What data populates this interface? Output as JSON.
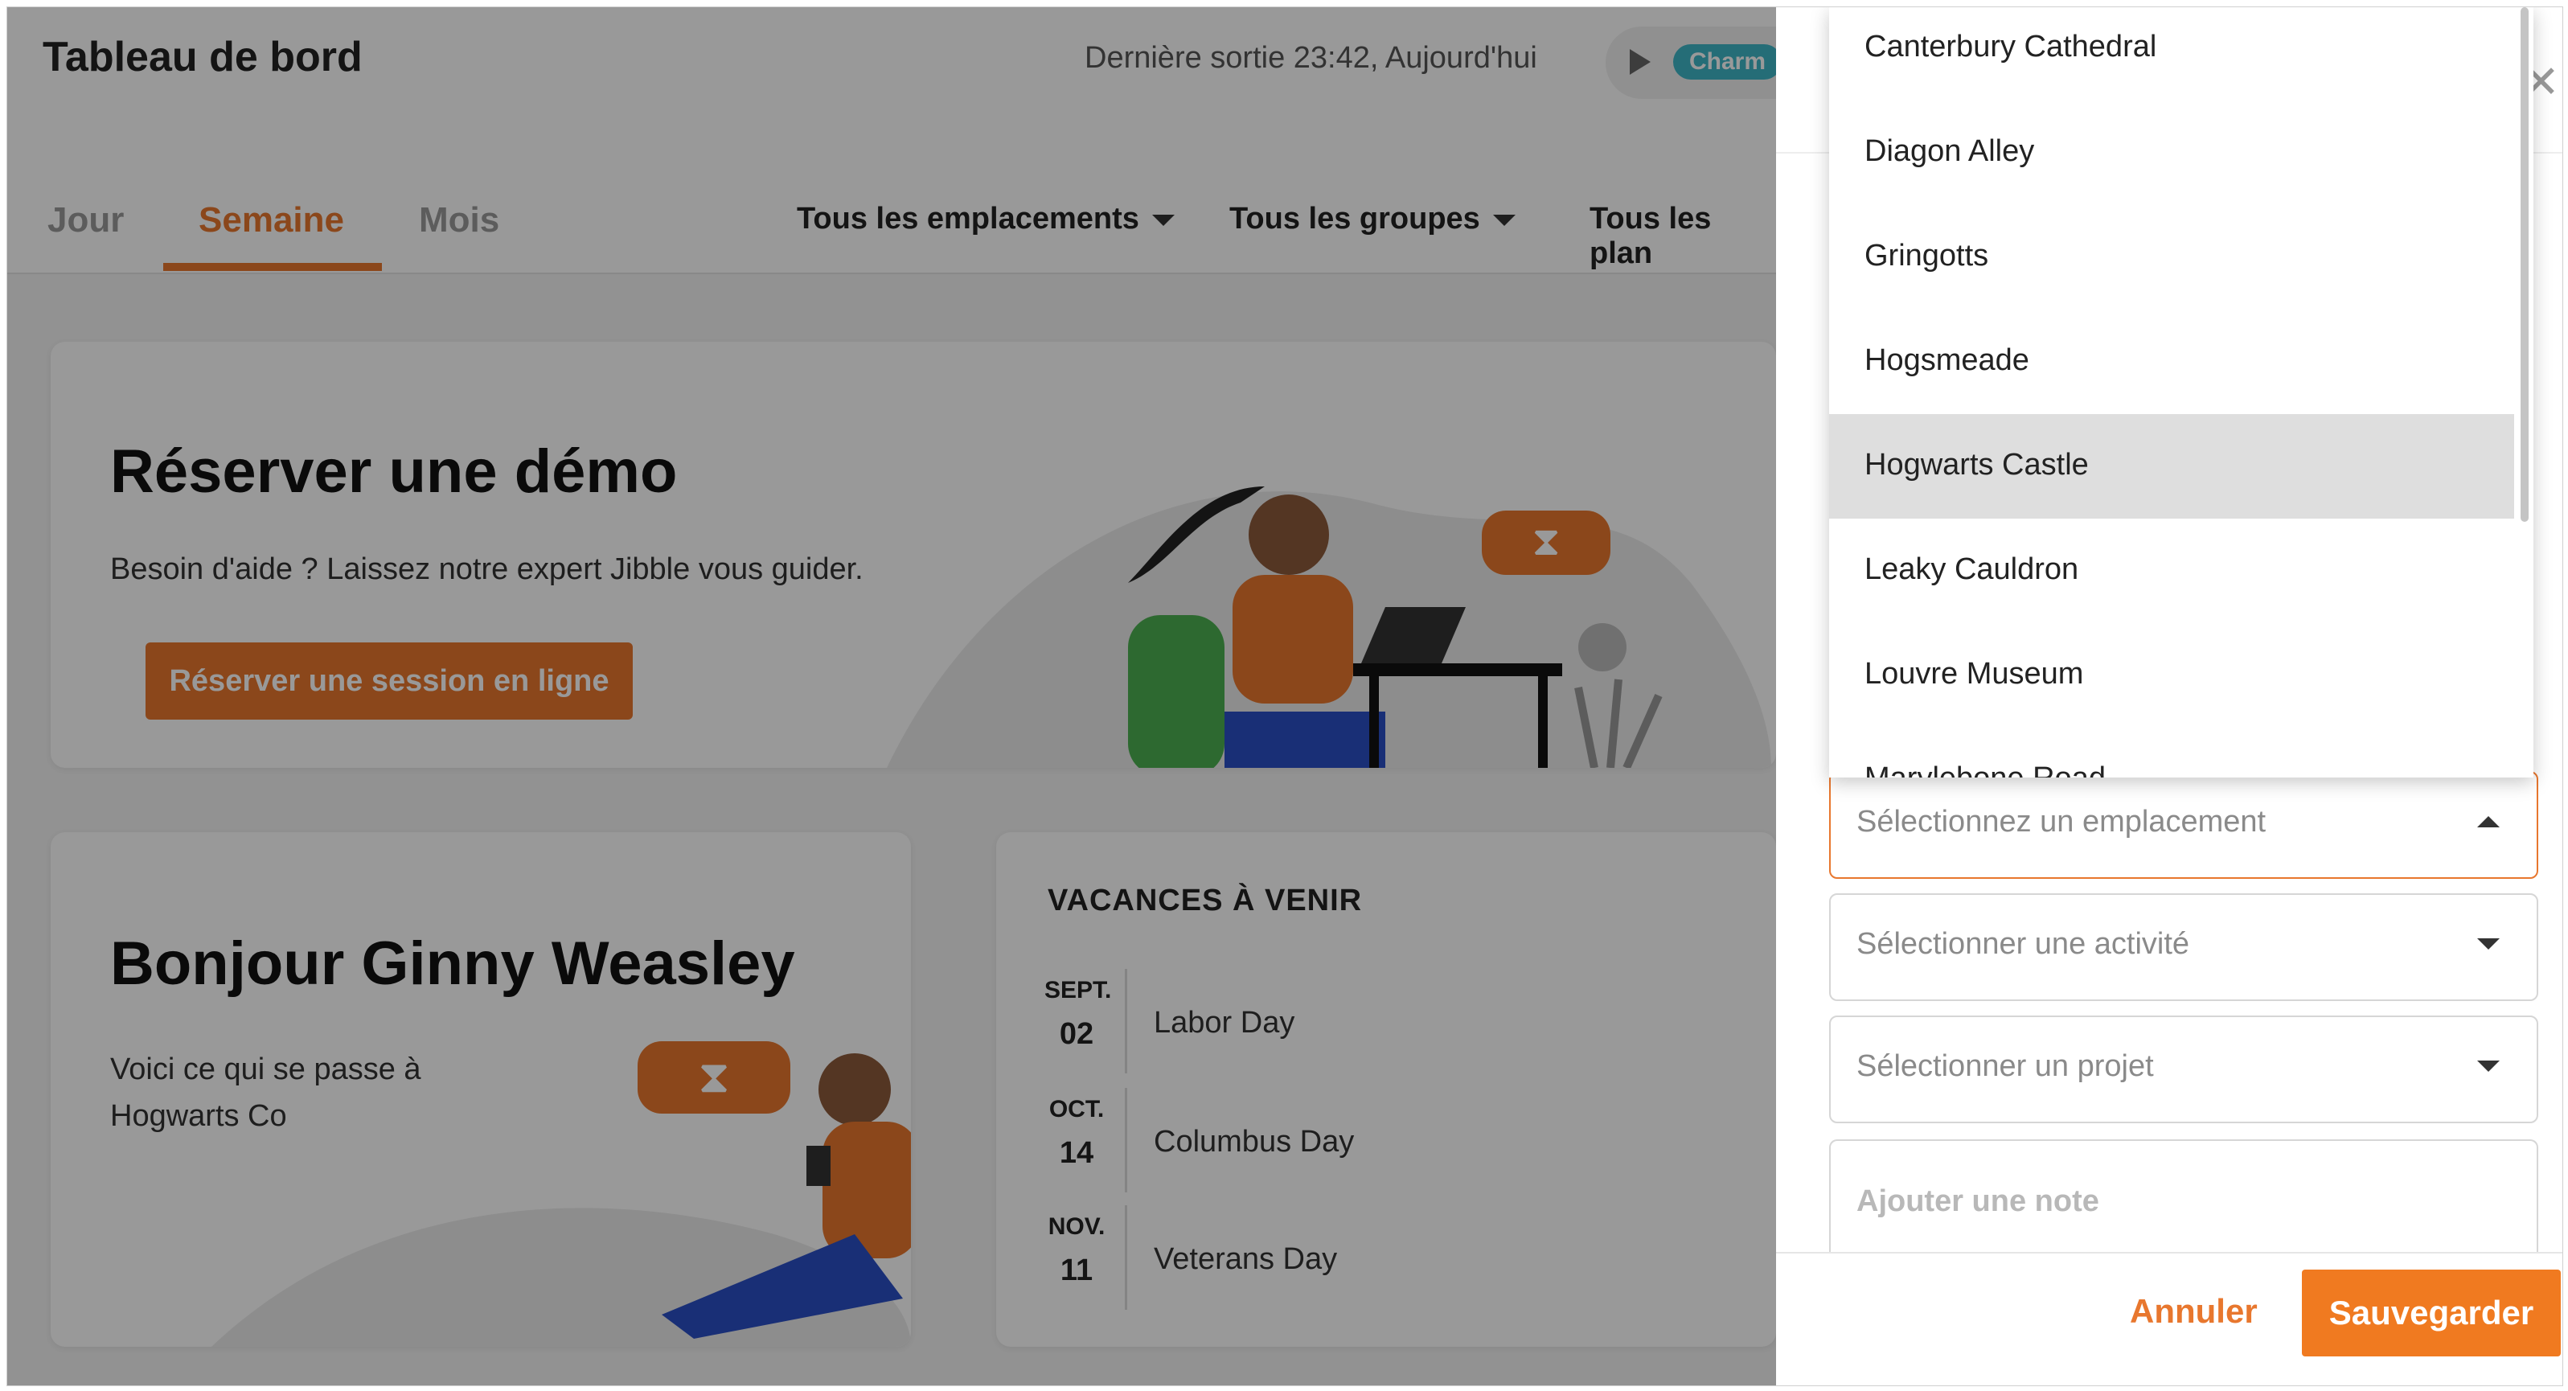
{
  "header": {
    "title": "Tableau de bord",
    "last_out": "Dernière sortie 23:42, Aujourd'hui",
    "timer_badge": "Charm"
  },
  "tabs": [
    {
      "label": "Jour"
    },
    {
      "label": "Semaine"
    },
    {
      "label": "Mois"
    }
  ],
  "filters": {
    "locations": "Tous les emplacements",
    "groups": "Tous les groupes",
    "schedules": "Tous les plan"
  },
  "demo_card": {
    "title": "Réserver une démo",
    "subtitle": "Besoin d'aide ? Laissez notre expert Jibble vous guider.",
    "button": "Réserver une session en ligne"
  },
  "greeting_card": {
    "title": "Bonjour Ginny Weasley",
    "line1": "Voici ce qui se passe à",
    "line2": "Hogwarts Co"
  },
  "holidays": {
    "title": "VACANCES À VENIR",
    "items": [
      {
        "month": "SEPT.",
        "day": "02",
        "name": "Labor Day"
      },
      {
        "month": "OCT.",
        "day": "14",
        "name": "Columbus Day"
      },
      {
        "month": "NOV.",
        "day": "11",
        "name": "Veterans Day"
      }
    ]
  },
  "location_dropdown": {
    "options": [
      "Canterbury Cathedral",
      "Diagon Alley",
      "Gringotts",
      "Hogsmeade",
      "Hogwarts Castle",
      "Leaky Cauldron",
      "Louvre Museum",
      "Marylebone Road"
    ],
    "highlighted": "Hogwarts Castle"
  },
  "form": {
    "location_placeholder": "Sélectionnez un emplacement",
    "activity_placeholder": "Sélectionner une activité",
    "project_placeholder": "Sélectionner un projet",
    "note_placeholder": "Ajouter une note"
  },
  "actions": {
    "cancel": "Annuler",
    "save": "Sauvegarder"
  },
  "colors": {
    "accent": "#e8772e",
    "save": "#f07a20",
    "teal": "#3fb6c7"
  }
}
